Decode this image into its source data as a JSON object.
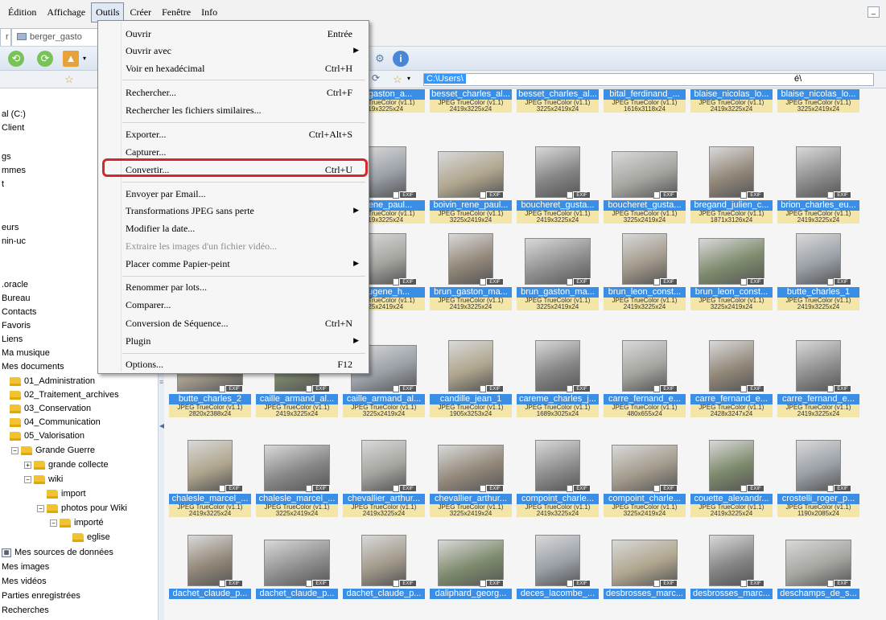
{
  "menubar": {
    "items": [
      {
        "label": "Édition"
      },
      {
        "label": "Affichage"
      },
      {
        "label": "Outils",
        "active": true
      },
      {
        "label": "Créer"
      },
      {
        "label": "Fenêtre"
      },
      {
        "label": "Info"
      }
    ],
    "minimize_label": "_"
  },
  "tabs": [
    {
      "label": "r"
    },
    {
      "label": "berger_gasto"
    }
  ],
  "address": {
    "path": "C:\\Users\\",
    "tail": "é\\"
  },
  "dropdown": {
    "items": [
      {
        "label": "Ouvrir",
        "shortcut": "Entrée"
      },
      {
        "label": "Ouvrir avec",
        "submenu": true
      },
      {
        "label": "Voir en hexadécimal",
        "shortcut": "Ctrl+H"
      },
      {
        "label": "Rechercher...",
        "shortcut": "Ctrl+F"
      },
      {
        "label": "Rechercher les fichiers similaires..."
      },
      {
        "label": "Exporter...",
        "shortcut": "Ctrl+Alt+S"
      },
      {
        "label": "Capturer..."
      },
      {
        "label": "Convertir...",
        "shortcut": "Ctrl+U",
        "highlighted": true
      },
      {
        "label": "Envoyer par Email..."
      },
      {
        "label": "Transformations JPEG sans perte",
        "submenu": true
      },
      {
        "label": "Modifier la date..."
      },
      {
        "label": "Extraire les images d'un fichier vidéo...",
        "disabled": true
      },
      {
        "label": "Placer comme Papier-peint",
        "submenu": true
      },
      {
        "label": "Renommer par lots..."
      },
      {
        "label": "Comparer..."
      },
      {
        "label": "Conversion de Séquence...",
        "shortcut": "Ctrl+N"
      },
      {
        "label": "Plugin",
        "submenu": true
      },
      {
        "label": "Options...",
        "shortcut": "F12"
      }
    ]
  },
  "tree": {
    "items": [
      {
        "label": "al (C:)"
      },
      {
        "label": "Client"
      },
      {
        "label": "gs"
      },
      {
        "label": "mmes"
      },
      {
        "label": "t"
      },
      {
        "label": "eurs"
      },
      {
        "label": "nin-uc"
      },
      {
        "label": ".oracle"
      },
      {
        "label": "Bureau"
      },
      {
        "label": "Contacts"
      },
      {
        "label": "Favoris"
      },
      {
        "label": "Liens"
      },
      {
        "label": "Ma musique"
      },
      {
        "label": "Mes documents"
      },
      {
        "label": "01_Administration"
      },
      {
        "label": "02_Traitement_archives"
      },
      {
        "label": "03_Conservation"
      },
      {
        "label": "04_Communication"
      },
      {
        "label": "05_Valorisation"
      },
      {
        "label": "Grande Guerre"
      },
      {
        "label": "grande collecte"
      },
      {
        "label": "wiki"
      },
      {
        "label": "import"
      },
      {
        "label": "photos pour Wiki"
      },
      {
        "label": "importé"
      },
      {
        "label": "eglise"
      },
      {
        "label": "Mes sources de données"
      },
      {
        "label": "Mes images"
      },
      {
        "label": "Mes vidéos"
      },
      {
        "label": "Parties enregistrées"
      },
      {
        "label": "Recherches"
      }
    ]
  },
  "thumbnails": {
    "exif_label": "EXIF",
    "rows": [
      [
        {
          "name": "er_gaston_a...",
          "format": "PEG TrueColor (v1.1)",
          "dims": "419x3225x24"
        },
        {
          "name": "besset_charles_al...",
          "format": "JPEG TrueColor (v1.1)",
          "dims": "2419x3225x24"
        },
        {
          "name": "besset_charles_al...",
          "format": "JPEG TrueColor (v1.1)",
          "dims": "3225x2419x24"
        },
        {
          "name": "bital_ferdinand_...",
          "format": "JPEG TrueColor (v1.1)",
          "dims": "1616x3118x24"
        },
        {
          "name": "blaise_nicolas_lo...",
          "format": "JPEG TrueColor (v1.1)",
          "dims": "2419x3225x24"
        },
        {
          "name": "blaise_nicolas_lo...",
          "format": "JPEG TrueColor (v1.1)",
          "dims": "3225x2419x24"
        }
      ],
      [
        {
          "name": "n_rene_paul...",
          "format": "PEG TrueColor (v1.1)",
          "dims": "419x3225x24"
        },
        {
          "name": "boivin_rene_paul...",
          "format": "JPEG TrueColor (v1.1)",
          "dims": "3225x2419x24"
        },
        {
          "name": "boucheret_gusta...",
          "format": "JPEG TrueColor (v1.1)",
          "dims": "2419x3225x24"
        },
        {
          "name": "boucheret_gusta...",
          "format": "JPEG TrueColor (v1.1)",
          "dims": "3225x2419x24"
        },
        {
          "name": "bregand_julien_c...",
          "format": "JPEG TrueColor (v1.1)",
          "dims": "1871x3126x24"
        },
        {
          "name": "brion_charles_eu...",
          "format": "JPEG TrueColor (v1.1)",
          "dims": "2419x3225x24"
        }
      ],
      [
        {
          "name": "_eugene_h...",
          "format": "PEG TrueColor (v1.1)",
          "dims": "225x2419x24"
        },
        {
          "name": "brun_gaston_ma...",
          "format": "JPEG TrueColor (v1.1)",
          "dims": "2419x3225x24"
        },
        {
          "name": "brun_gaston_ma...",
          "format": "JPEG TrueColor (v1.1)",
          "dims": "3225x2419x24"
        },
        {
          "name": "brun_leon_const...",
          "format": "JPEG TrueColor (v1.1)",
          "dims": "2419x3225x24"
        },
        {
          "name": "brun_leon_const...",
          "format": "JPEG TrueColor (v1.1)",
          "dims": "3225x2419x24"
        },
        {
          "name": "butte_charles_1",
          "format": "JPEG TrueColor (v1.1)",
          "dims": "2419x3225x24"
        }
      ],
      [
        {
          "name": "butte_charles_2",
          "format": "JPEG TrueColor (v1.1)",
          "dims": "2820x2388x24"
        },
        {
          "name": "caille_armand_al...",
          "format": "JPEG TrueColor (v1.1)",
          "dims": "2419x3225x24"
        },
        {
          "name": "caille_armand_al...",
          "format": "JPEG TrueColor (v1.1)",
          "dims": "3225x2419x24"
        },
        {
          "name": "candille_jean_1",
          "format": "JPEG TrueColor (v1.1)",
          "dims": "1905x3253x24"
        },
        {
          "name": "careme_charles_j...",
          "format": "JPEG TrueColor (v1.1)",
          "dims": "1689x3025x24"
        },
        {
          "name": "carre_fernand_e...",
          "format": "JPEG TrueColor (v1.1)",
          "dims": "480x655x24"
        },
        {
          "name": "carre_fernand_e...",
          "format": "JPEG TrueColor (v1.1)",
          "dims": "2428x3247x24"
        },
        {
          "name": "carre_fernand_e...",
          "format": "JPEG TrueColor (v1.1)",
          "dims": "2419x3225x24"
        }
      ],
      [
        {
          "name": "chalesle_marcel_...",
          "format": "JPEG TrueColor (v1.1)",
          "dims": "2419x3225x24"
        },
        {
          "name": "chalesle_marcel_...",
          "format": "JPEG TrueColor (v1.1)",
          "dims": "3225x2419x24"
        },
        {
          "name": "chevallier_arthur...",
          "format": "JPEG TrueColor (v1.1)",
          "dims": "2419x3225x24"
        },
        {
          "name": "chevallier_arthur...",
          "format": "JPEG TrueColor (v1.1)",
          "dims": "3225x2419x24"
        },
        {
          "name": "compoint_charle...",
          "format": "JPEG TrueColor (v1.1)",
          "dims": "2419x3225x24"
        },
        {
          "name": "compoint_charle...",
          "format": "JPEG TrueColor (v1.1)",
          "dims": "3225x2419x24"
        },
        {
          "name": "couette_alexandr...",
          "format": "JPEG TrueColor (v1.1)",
          "dims": "2419x3225x24"
        },
        {
          "name": "crostelli_roger_p...",
          "format": "JPEG TrueColor (v1.1)",
          "dims": "1190x2085x24"
        }
      ],
      [
        {
          "name": "dachet_claude_p...",
          "format": "",
          "dims": ""
        },
        {
          "name": "dachet_claude_p...",
          "format": "",
          "dims": ""
        },
        {
          "name": "dachet_claude_p...",
          "format": "",
          "dims": ""
        },
        {
          "name": "daliphard_georg...",
          "format": "",
          "dims": ""
        },
        {
          "name": "deces_lacombe_...",
          "format": "",
          "dims": ""
        },
        {
          "name": "desbrosses_marc...",
          "format": "",
          "dims": ""
        },
        {
          "name": "desbrosses_marc...",
          "format": "",
          "dims": ""
        },
        {
          "name": "deschamps_de_s...",
          "format": "",
          "dims": ""
        }
      ]
    ]
  },
  "colors": {
    "selection": "#3a8ee6",
    "info_bg": "#f4e6a8",
    "highlight_ring": "#d3272b"
  }
}
